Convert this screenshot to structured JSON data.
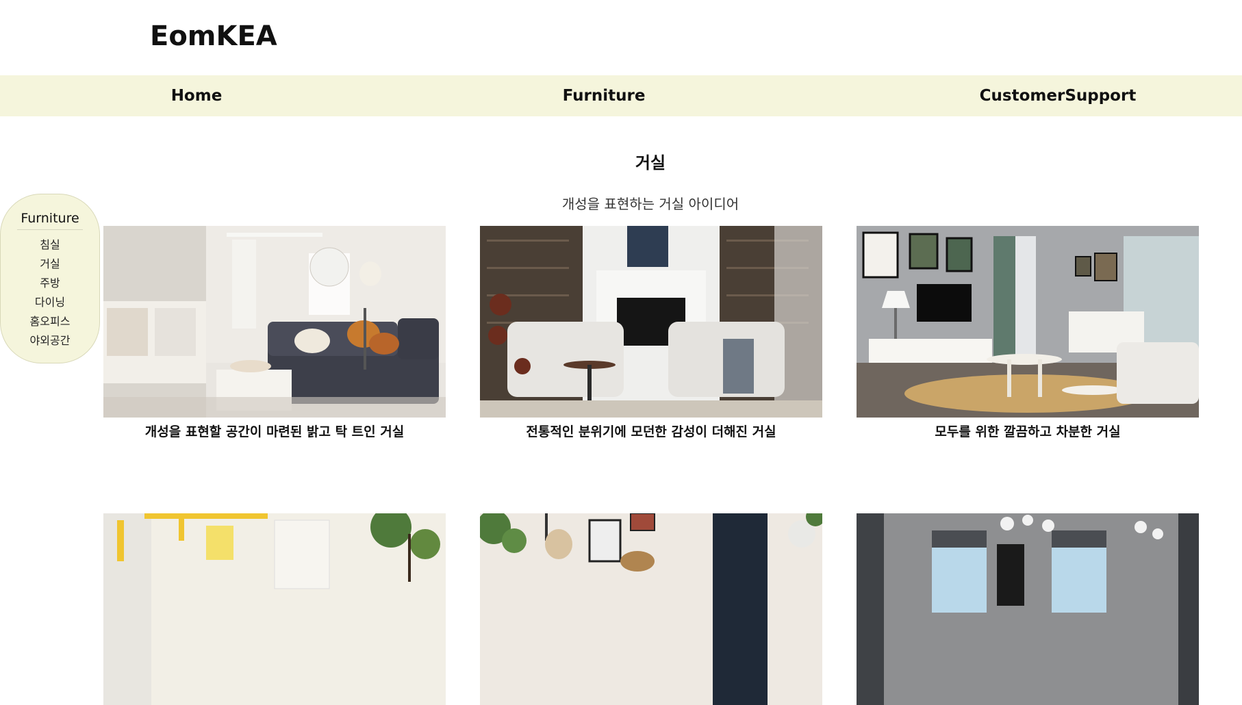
{
  "brand": {
    "logo": "EomKEA"
  },
  "nav": {
    "home": "Home",
    "furniture": "Furniture",
    "support": "CustomerSupport"
  },
  "section": {
    "title": "거실",
    "subtitle": "개성을 표현하는 거실 아이디어"
  },
  "sidebar": {
    "title": "Furniture",
    "items": [
      "침실",
      "거실",
      "주방",
      "다이닝",
      "홈오피스",
      "야외공간"
    ]
  },
  "cards": [
    {
      "caption": "개성을 표현할 공간이 마련된 밝고 탁 트인 거실"
    },
    {
      "caption": "전통적인 분위기에 모던한 감성이 더해진 거실"
    },
    {
      "caption": "모두를 위한 깔끔하고 차분한 거실"
    }
  ],
  "colors": {
    "nav_bg": "#f5f5dc",
    "sidebar_bg": "#f5f5dc",
    "text": "#111111"
  }
}
